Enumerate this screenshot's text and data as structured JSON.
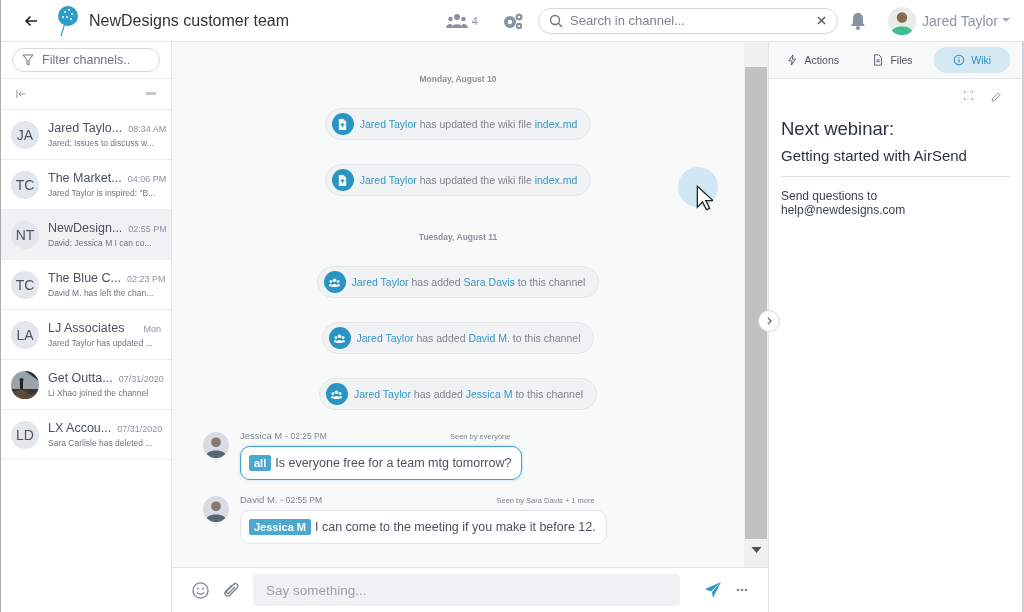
{
  "header": {
    "title": "NewDesigns customer team",
    "member_count": "4",
    "search": {
      "placeholder": "Search in channel..."
    },
    "user": {
      "name": "Jared Taylor"
    }
  },
  "sidebar": {
    "filter": {
      "placeholder": "Filter channels.."
    },
    "channels": [
      {
        "initials": "JA",
        "name": "Jared Taylo...",
        "time": "08:34 AM",
        "preview": "Jared: Issues to discuss w...",
        "selected": false
      },
      {
        "initials": "TC",
        "name": "The Market...",
        "time": "04:06 PM",
        "preview": "Jared Taylor is inspired: \"B...",
        "selected": false
      },
      {
        "initials": "NT",
        "name": "NewDesign...",
        "time": "02:55 PM",
        "preview": "David: Jessica M I can co...",
        "selected": true
      },
      {
        "initials": "TC",
        "name": "The Blue C...",
        "time": "02:23 PM",
        "preview": "David M. has left the chan...",
        "selected": false
      },
      {
        "initials": "LA",
        "name": "LJ Associates",
        "time": "Mon",
        "preview": "Jared Taylor has updated ...",
        "selected": false
      },
      {
        "kind": "picture",
        "name": "Get Outta...",
        "time": "07/31/2020",
        "preview": "Li Xhao joined the channel",
        "selected": false
      },
      {
        "initials": "LD",
        "name": "LX Accou...",
        "time": "07/31/2020",
        "preview": "Sara Carlisle has deleted ...",
        "selected": false
      }
    ]
  },
  "chat": {
    "items": [
      {
        "kind": "date",
        "text": "Monday, August 10"
      },
      {
        "kind": "file_event",
        "parts": [
          {
            "text": "Jared Taylor",
            "link": true
          },
          {
            "text": " has updated the wiki file ",
            "link": false
          },
          {
            "text": "index.md",
            "link": true
          }
        ]
      },
      {
        "kind": "file_event",
        "parts": [
          {
            "text": "Jared Taylor",
            "link": true
          },
          {
            "text": " has updated the wiki file ",
            "link": false
          },
          {
            "text": "index.md",
            "link": true
          }
        ]
      },
      {
        "kind": "date",
        "text": "Tuesday, August 11"
      },
      {
        "kind": "member_event",
        "parts": [
          {
            "text": "Jared Taylor",
            "link": true
          },
          {
            "text": " has added ",
            "link": false
          },
          {
            "text": "Sara Davis",
            "link": true
          },
          {
            "text": " to this channel",
            "link": false
          }
        ]
      },
      {
        "kind": "member_event",
        "parts": [
          {
            "text": "Jared Taylor",
            "link": true
          },
          {
            "text": " has added ",
            "link": false
          },
          {
            "text": "David M.",
            "link": true
          },
          {
            "text": " to this channel",
            "link": false
          }
        ]
      },
      {
        "kind": "member_event",
        "parts": [
          {
            "text": "Jared Taylor",
            "link": true
          },
          {
            "text": " has added ",
            "link": false
          },
          {
            "text": "Jessica M",
            "link": true
          },
          {
            "text": " to this channel",
            "link": false
          }
        ]
      },
      {
        "kind": "message",
        "author": "Jessica M",
        "time": "- 02:25 PM",
        "seen": "Seen by everyone",
        "mention": "all",
        "text": "Is everyone free for a team mtg tomorrow?",
        "highlighted": true
      },
      {
        "kind": "message",
        "author": "David M.",
        "time": "- 02:55 PM",
        "seen": "Seen by Sara Davis + 1 more",
        "mention": "Jessica M",
        "text": "I can come to the meeting if you make it before 12.",
        "highlighted": false
      }
    ],
    "composer": {
      "placeholder": "Say something..."
    }
  },
  "panel": {
    "tabs": [
      {
        "label": "Actions",
        "selected": false
      },
      {
        "label": "Files",
        "selected": false
      },
      {
        "label": "Wiki",
        "selected": true
      }
    ],
    "wiki": {
      "heading": "Next webinar:",
      "subheading": "Getting started with AirSend",
      "body": "Send questions to help@newdesigns.com"
    }
  }
}
